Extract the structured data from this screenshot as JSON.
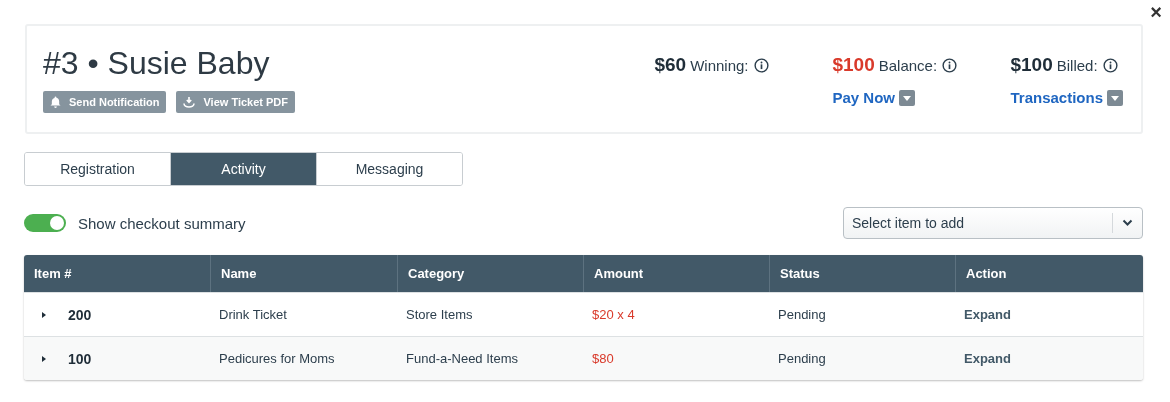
{
  "close": "×",
  "header": {
    "title": "#3 • Susie Baby",
    "actions": [
      {
        "label": "Send Notification",
        "kind": "bell"
      },
      {
        "label": "View Ticket PDF",
        "kind": "download"
      }
    ],
    "stats": [
      {
        "amount": "$60",
        "label": "Winning:",
        "highlight": false
      },
      {
        "amount": "$100",
        "label": "Balance:",
        "highlight": true,
        "link": "Pay Now"
      },
      {
        "amount": "$100",
        "label": "Billed:",
        "highlight": false,
        "link": "Transactions"
      }
    ]
  },
  "tabs": [
    {
      "label": "Registration",
      "selected": false
    },
    {
      "label": "Activity",
      "selected": true
    },
    {
      "label": "Messaging",
      "selected": false
    }
  ],
  "checkout_toggle": {
    "label": "Show checkout summary",
    "on": true
  },
  "item_select": {
    "placeholder": "Select item to add"
  },
  "table": {
    "columns": [
      "Item #",
      "Name",
      "Category",
      "Amount",
      "Status",
      "Action"
    ],
    "rows": [
      {
        "expanded": false,
        "item": "200",
        "name": "Drink Ticket",
        "category": "Store Items",
        "amount": "$20 x 4",
        "status": "Pending",
        "action": "Expand"
      },
      {
        "expanded": false,
        "item": "100",
        "name": "Pedicures for Moms",
        "category": "Fund-a-Need Items",
        "amount": "$80",
        "status": "Pending",
        "action": "Expand"
      }
    ]
  }
}
